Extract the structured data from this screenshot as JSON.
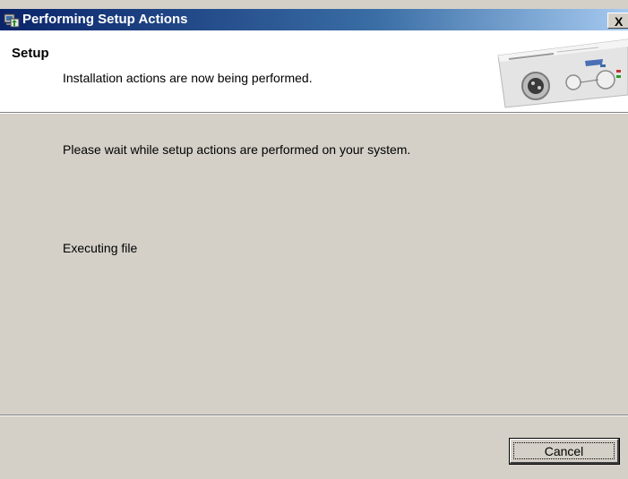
{
  "window": {
    "title": "Performing Setup Actions",
    "close_label": "X"
  },
  "header": {
    "title": "Setup",
    "subtitle": "Installation actions are now being performed."
  },
  "content": {
    "message": "Please wait while setup actions are performed on your system.",
    "status": "Executing file"
  },
  "footer": {
    "cancel_label": "Cancel"
  },
  "colors": {
    "titlebar_start": "#0a246a",
    "titlebar_end": "#a6caf0",
    "dialog_bg": "#d4d0c8",
    "header_bg": "#ffffff"
  }
}
